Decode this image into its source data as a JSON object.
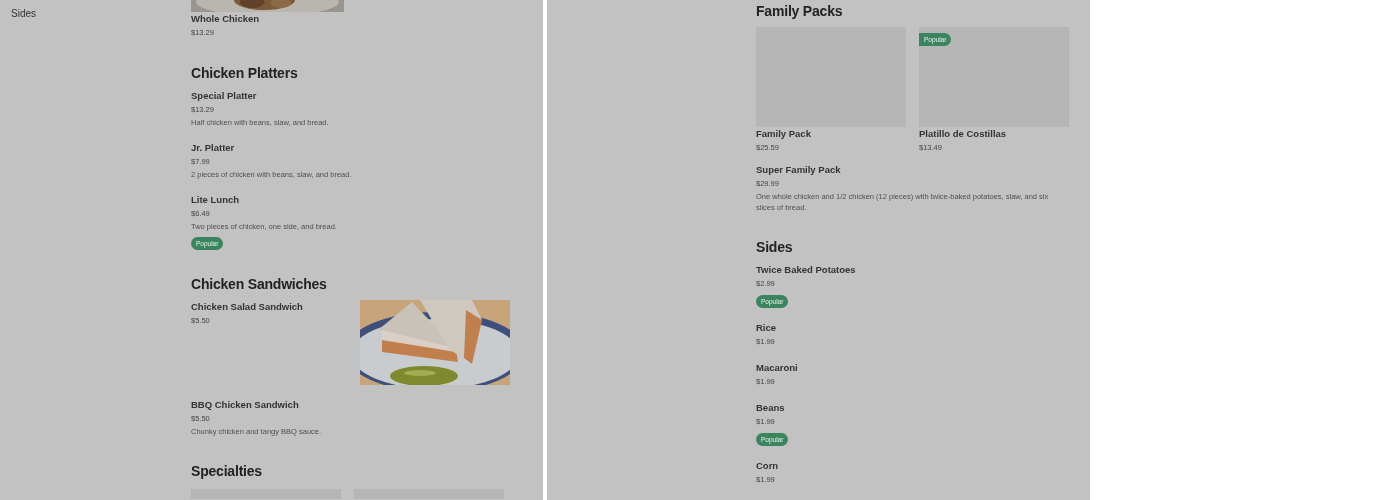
{
  "panels": [
    {
      "sidebar": {
        "items": [
          {
            "label": "Sides"
          }
        ]
      },
      "sections": [
        {
          "items": [
            {
              "kind": "photocard",
              "name": "Whole Chicken",
              "price": "$13.29"
            }
          ]
        },
        {
          "title": "Chicken Platters",
          "items": [
            {
              "kind": "row",
              "name": "Special Platter",
              "price": "$13.29",
              "description": "Half chicken with beans, slaw, and bread."
            },
            {
              "kind": "row",
              "name": "Jr. Platter",
              "price": "$7.99",
              "description": "2 pieces of chicken with beans, slaw, and bread."
            },
            {
              "kind": "row",
              "name": "Lite Lunch",
              "price": "$6.49",
              "description": "Two pieces of chicken, one side, and bread.",
              "badge": "Popular"
            }
          ]
        },
        {
          "title": "Chicken Sandwiches",
          "items": [
            {
              "kind": "photorow",
              "name": "Chicken Salad Sandwich",
              "price": "$5.50"
            },
            {
              "kind": "row",
              "name": "BBQ Chicken Sandwich",
              "price": "$5.50",
              "description": "Chunky chicken and tangy BBQ sauce."
            }
          ]
        },
        {
          "title": "Specialties",
          "items": [
            {
              "kind": "card"
            },
            {
              "kind": "card"
            }
          ]
        }
      ]
    },
    {
      "sections": [
        {
          "title": "Family Packs",
          "items": [
            {
              "kind": "card",
              "name": "Family Pack",
              "price": "$25.59"
            },
            {
              "kind": "card",
              "name": "Platillo de Costillas",
              "price": "$13.49",
              "badge": "Popular"
            },
            {
              "kind": "row",
              "name": "Super Family Pack",
              "price": "$29.99",
              "description": "One whole chicken and 1/2 chicken (12 pieces) with twice-baked potatoes, slaw, and six slices of bread."
            }
          ]
        },
        {
          "title": "Sides",
          "items": [
            {
              "kind": "row",
              "name": "Twice Baked Potatoes",
              "price": "$2.99",
              "badge": "Popular"
            },
            {
              "kind": "row",
              "name": "Rice",
              "price": "$1.99"
            },
            {
              "kind": "row",
              "name": "Macaroni",
              "price": "$1.99"
            },
            {
              "kind": "row",
              "name": "Beans",
              "price": "$1.99",
              "badge": "Popular"
            },
            {
              "kind": "row",
              "name": "Corn",
              "price": "$1.99"
            }
          ]
        }
      ]
    }
  ]
}
